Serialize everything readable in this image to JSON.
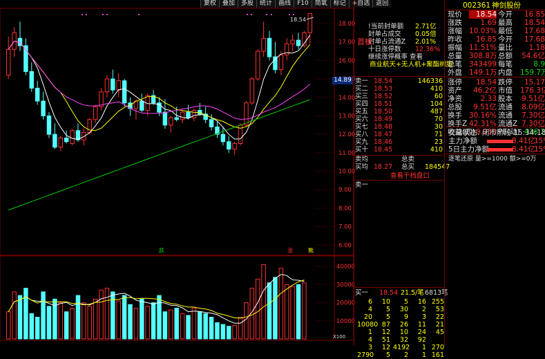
{
  "toolbar": [
    "复权",
    "叠加",
    "多股",
    "统计",
    "画线",
    "F10",
    "简氧",
    "标记",
    "+自选",
    "返回"
  ],
  "kline": {
    "price_labels": [
      "18.00",
      "17.00",
      "16.00",
      "15.00",
      "14.00",
      "13.00",
      "12.00",
      "11.00",
      "10.00",
      "9.00",
      "8.00",
      "7.00",
      "6.00"
    ],
    "price_min": 5.6,
    "price_max": 18.6,
    "current_price_tag": "14.89",
    "high_label": "18.54",
    "vol_labels": [
      "40000",
      "30000",
      "20000",
      "10000"
    ],
    "vol_max": 42000,
    "vol_mode": "X100",
    "markers": [
      "跌",
      "涨",
      "熊"
    ],
    "candles": [
      {
        "o": 15.2,
        "h": 17.3,
        "l": 15.0,
        "c": 16.6
      },
      {
        "o": 16.6,
        "h": 17.8,
        "l": 16.2,
        "c": 17.5
      },
      {
        "o": 17.2,
        "h": 18.1,
        "l": 16.5,
        "c": 16.8
      },
      {
        "o": 16.8,
        "h": 17.2,
        "l": 15.2,
        "c": 15.4
      },
      {
        "o": 15.4,
        "h": 15.9,
        "l": 14.3,
        "c": 14.5
      },
      {
        "o": 14.5,
        "h": 14.9,
        "l": 13.6,
        "c": 13.8
      },
      {
        "o": 13.8,
        "h": 14.3,
        "l": 12.8,
        "c": 13.0
      },
      {
        "o": 13.0,
        "h": 13.2,
        "l": 11.8,
        "c": 12.0
      },
      {
        "o": 12.0,
        "h": 12.6,
        "l": 11.2,
        "c": 11.3
      },
      {
        "o": 11.3,
        "h": 11.9,
        "l": 11.1,
        "c": 11.8
      },
      {
        "o": 11.8,
        "h": 12.2,
        "l": 11.5,
        "c": 11.6
      },
      {
        "o": 11.5,
        "h": 12.3,
        "l": 11.4,
        "c": 12.2
      },
      {
        "o": 12.2,
        "h": 12.6,
        "l": 11.6,
        "c": 11.7
      },
      {
        "o": 11.7,
        "h": 12.3,
        "l": 11.4,
        "c": 12.1
      },
      {
        "o": 12.1,
        "h": 12.9,
        "l": 12.0,
        "c": 12.8
      },
      {
        "o": 12.8,
        "h": 13.6,
        "l": 12.6,
        "c": 13.5
      },
      {
        "o": 13.5,
        "h": 14.5,
        "l": 13.3,
        "c": 14.3
      },
      {
        "o": 14.3,
        "h": 15.2,
        "l": 14.0,
        "c": 15.0
      },
      {
        "o": 15.0,
        "h": 15.5,
        "l": 14.2,
        "c": 14.4
      },
      {
        "o": 14.4,
        "h": 15.3,
        "l": 14.0,
        "c": 14.9
      },
      {
        "o": 14.9,
        "h": 15.0,
        "l": 13.5,
        "c": 13.7
      },
      {
        "o": 13.7,
        "h": 14.0,
        "l": 13.0,
        "c": 13.4
      },
      {
        "o": 13.4,
        "h": 13.9,
        "l": 12.8,
        "c": 13.8
      },
      {
        "o": 13.8,
        "h": 14.2,
        "l": 13.2,
        "c": 13.3
      },
      {
        "o": 13.3,
        "h": 14.2,
        "l": 13.0,
        "c": 14.1
      },
      {
        "o": 14.1,
        "h": 14.4,
        "l": 13.6,
        "c": 13.7
      },
      {
        "o": 13.7,
        "h": 14.0,
        "l": 13.0,
        "c": 13.2
      },
      {
        "o": 13.2,
        "h": 13.9,
        "l": 12.3,
        "c": 12.5
      },
      {
        "o": 12.5,
        "h": 13.0,
        "l": 12.1,
        "c": 12.9
      },
      {
        "o": 12.9,
        "h": 13.5,
        "l": 12.7,
        "c": 12.8
      },
      {
        "o": 12.8,
        "h": 13.3,
        "l": 12.6,
        "c": 13.2
      },
      {
        "o": 13.2,
        "h": 13.6,
        "l": 12.8,
        "c": 12.9
      },
      {
        "o": 12.9,
        "h": 13.4,
        "l": 12.7,
        "c": 13.3
      },
      {
        "o": 13.3,
        "h": 13.7,
        "l": 13.0,
        "c": 13.1
      },
      {
        "o": 13.1,
        "h": 13.5,
        "l": 12.6,
        "c": 12.8
      },
      {
        "o": 12.8,
        "h": 13.1,
        "l": 12.2,
        "c": 12.4
      },
      {
        "o": 12.4,
        "h": 12.7,
        "l": 11.8,
        "c": 12.0
      },
      {
        "o": 12.0,
        "h": 12.4,
        "l": 11.4,
        "c": 11.6
      },
      {
        "o": 11.6,
        "h": 11.9,
        "l": 11.0,
        "c": 11.2
      },
      {
        "o": 11.2,
        "h": 11.6,
        "l": 10.9,
        "c": 11.5
      },
      {
        "o": 11.5,
        "h": 12.6,
        "l": 11.4,
        "c": 12.5
      },
      {
        "o": 12.5,
        "h": 13.8,
        "l": 12.4,
        "c": 13.7
      },
      {
        "o": 13.7,
        "h": 15.1,
        "l": 13.6,
        "c": 15.0
      },
      {
        "o": 15.0,
        "h": 16.6,
        "l": 14.9,
        "c": 16.5
      },
      {
        "o": 16.5,
        "h": 18.1,
        "l": 16.2,
        "c": 17.2
      },
      {
        "o": 17.2,
        "h": 17.6,
        "l": 16.0,
        "c": 16.2
      },
      {
        "o": 16.2,
        "h": 17.0,
        "l": 15.3,
        "c": 15.5
      },
      {
        "o": 15.5,
        "h": 16.5,
        "l": 15.2,
        "c": 16.3
      },
      {
        "o": 16.3,
        "h": 17.2,
        "l": 16.0,
        "c": 16.9
      },
      {
        "o": 16.9,
        "h": 17.4,
        "l": 16.5,
        "c": 17.1
      },
      {
        "o": 17.1,
        "h": 17.5,
        "l": 16.6,
        "c": 16.8
      },
      {
        "o": 16.8,
        "h": 17.6,
        "l": 16.7,
        "c": 17.5
      },
      {
        "o": 17.5,
        "h": 18.54,
        "l": 16.9,
        "c": 18.54
      }
    ],
    "volumes": [
      15000,
      26000,
      24000,
      28000,
      14000,
      12000,
      26000,
      18000,
      22000,
      20000,
      15000,
      17000,
      24000,
      20000,
      18000,
      22000,
      27000,
      28000,
      26000,
      21000,
      24000,
      19000,
      17000,
      22000,
      18000,
      20000,
      24000,
      15000,
      16000,
      17000,
      14000,
      13000,
      17000,
      15000,
      14000,
      12000,
      9000,
      8000,
      7000,
      7500,
      12000,
      20000,
      28000,
      33000,
      41000,
      31000,
      34000,
      39000,
      30000,
      29000,
      30000,
      31000
    ]
  },
  "info_panel": {
    "stats": [
      {
        "label": "!当前封单额",
        "value": "2.71亿"
      },
      {
        "label": "封单占成交",
        "value": "0.05倍"
      },
      {
        "label": "封单占流通Z",
        "value": "2.01%"
      },
      {
        "label": "十日涨停数",
        "value": "12.36%"
      }
    ],
    "link1": "继续涨停概率 查看",
    "concept": "商业航天+无人机+聚酯树脂",
    "first_board": "首板",
    "current_tag": "14.89",
    "sell_orders": [
      {
        "l": "卖一",
        "p": "18.54",
        "v": "146336"
      },
      {
        "l": "买二",
        "p": "18.53",
        "v": "410"
      },
      {
        "l": "买三",
        "p": "18.52",
        "v": "60"
      },
      {
        "l": "买四",
        "p": "18.51",
        "v": "104"
      },
      {
        "l": "买五",
        "p": "18.50",
        "v": "487"
      },
      {
        "l": "买六",
        "p": "18.49",
        "v": "70"
      },
      {
        "l": "买七",
        "p": "18.48",
        "v": "30"
      },
      {
        "l": "买八",
        "p": "18.47",
        "v": "71"
      },
      {
        "l": "买九",
        "p": "18.46",
        "v": "23"
      },
      {
        "l": "买十",
        "p": "18.45",
        "v": "410"
      }
    ],
    "avg_sell_label": "卖均",
    "total_sell_label": "总卖",
    "avg_buy_label": "买均",
    "avg_buy_value": "18.27",
    "total_buy_label": "总买",
    "total_buy_value": "184547",
    "qiandang_link": "查看千档盘口",
    "sell1_label": "卖一",
    "ticker_row": {
      "label": "买一",
      "price": "18.54",
      "avg": "21.5/笔",
      "count": "6813笔"
    },
    "ticker": [
      [
        "6",
        "10",
        "5",
        "16",
        "255"
      ],
      [
        "4",
        "5",
        "30",
        "2",
        "53"
      ],
      [
        "20",
        "5",
        "9",
        "3",
        "22"
      ],
      [
        "10080",
        "87",
        "26",
        "11",
        "21"
      ],
      [
        "1",
        "12",
        "10",
        "24",
        "45"
      ],
      [
        "4",
        "51",
        "32",
        "92"
      ],
      [
        "3",
        "12",
        "4192",
        "1",
        "270"
      ],
      [
        "2790",
        "5",
        "2",
        "1",
        "161"
      ]
    ]
  },
  "quote": {
    "code": "002361",
    "name": "神剑股份",
    "left": [
      {
        "label": "现价",
        "value": "18.54",
        "hl": true
      },
      {
        "label": "涨跌",
        "value": "1.69"
      },
      {
        "label": "涨幅",
        "value": "10.03%"
      },
      {
        "label": "昨收",
        "value": "16.85"
      },
      {
        "label": "振幅",
        "value": "11.51%"
      },
      {
        "label": "总量",
        "value": "308.8万"
      },
      {
        "label": "总笔",
        "value": "343499"
      },
      {
        "label": "外盘",
        "value": "149.1万"
      }
    ],
    "right": [
      {
        "label": "今开",
        "value": "16.85"
      },
      {
        "label": "最高",
        "value": "18.54"
      },
      {
        "label": "最低",
        "value": "17.68"
      },
      {
        "label": "今开",
        "value": "17.68"
      },
      {
        "label": "量比",
        "value": "1.18"
      },
      {
        "label": "总额",
        "value": "54.6亿"
      },
      {
        "label": "每笔",
        "value": "8.9"
      },
      {
        "label": "内盘",
        "value": "159.7万"
      }
    ],
    "left2": [
      {
        "label": "涨停",
        "value": "18.54"
      },
      {
        "label": "资产",
        "value": "46.2亿"
      },
      {
        "label": "净资",
        "value": "2.33"
      },
      {
        "label": "总股",
        "value": "9.51亿"
      },
      {
        "label": "换手",
        "value": "30.16%"
      },
      {
        "label": "换手Z",
        "value": "42.31%"
      },
      {
        "label": "收益(四)",
        "value": "0.030"
      }
    ],
    "right2": [
      {
        "label": "跌停",
        "value": "15.17"
      },
      {
        "label": "市值",
        "value": "176.3亿"
      },
      {
        "label": "股本",
        "value": "9.51亿"
      },
      {
        "label": "流通",
        "value": "8.09亿"
      },
      {
        "label": "流通",
        "value": "7.30亿"
      },
      {
        "label": "流通Z",
        "value": "7.30亿"
      },
      {
        "label": "PE(动)",
        "value": "436.2"
      }
    ],
    "status": "交易状态: 闭市阶段 15:34:18",
    "capital": [
      {
        "label": "主力净额",
        "value": "8.41亿",
        "pct": "15%"
      },
      {
        "label": "5日主力净额",
        "value": "8.41亿",
        "pct": "15%"
      }
    ],
    "footer": "逐笔还原  量>=1000  额>=0万"
  }
}
